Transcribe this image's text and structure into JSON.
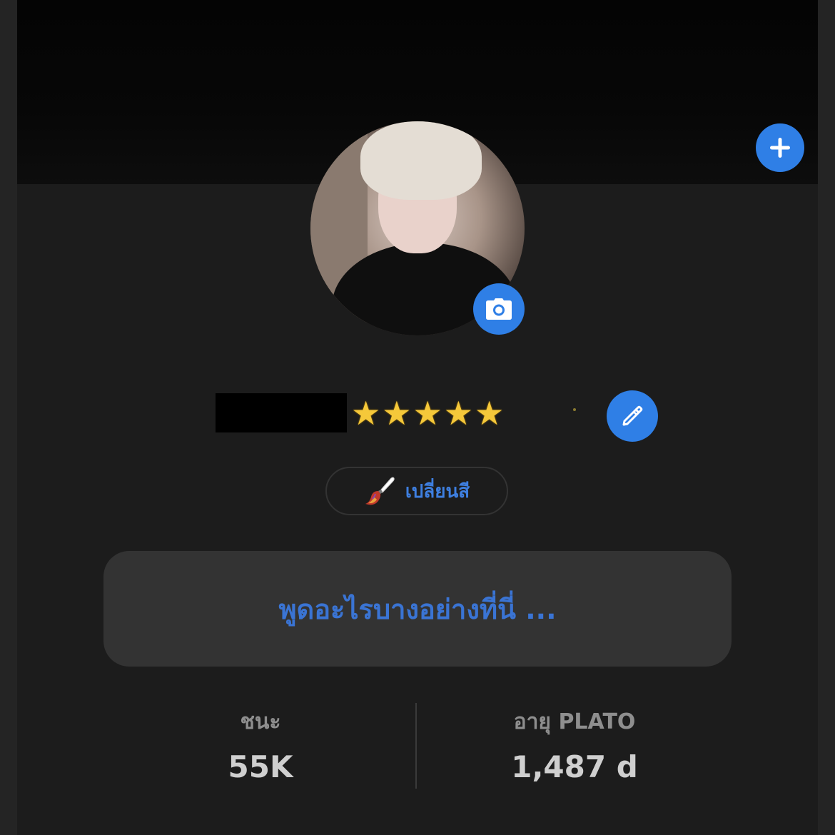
{
  "profile": {
    "rating_stars": 5,
    "change_color_label": "เปลี่ยนสี",
    "status_placeholder": "พูดอะไรบางอย่างที่นี่ ...",
    "name_redacted": true
  },
  "stats": {
    "wins_label": "ชนะ",
    "wins_value": "55K",
    "age_label": "อายุ PLATO",
    "age_value": "1,487 d"
  },
  "colors": {
    "accent": "#2f7fe6",
    "background": "#1c1c1c",
    "status_box": "#333333",
    "label_blue": "#3e7fe0"
  },
  "icons": {
    "add": "plus-icon",
    "camera": "camera-icon",
    "edit": "pencil-icon",
    "paintbrush": "paintbrush-icon",
    "star": "star-icon"
  }
}
